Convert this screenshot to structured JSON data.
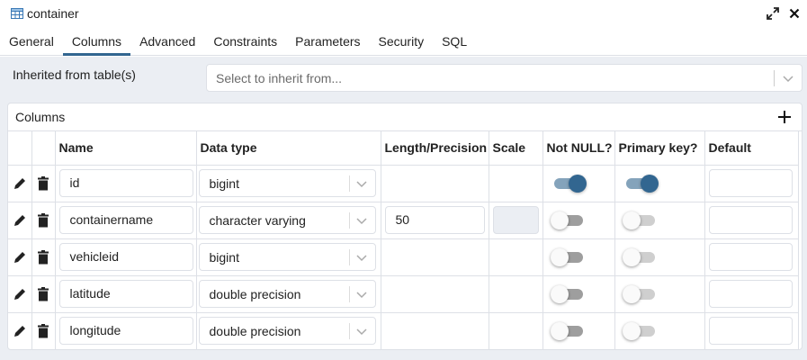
{
  "window": {
    "title": "container",
    "title_icon": "table-icon"
  },
  "tabs": [
    {
      "label": "General",
      "active": false
    },
    {
      "label": "Columns",
      "active": true
    },
    {
      "label": "Advanced",
      "active": false
    },
    {
      "label": "Constraints",
      "active": false
    },
    {
      "label": "Parameters",
      "active": false
    },
    {
      "label": "Security",
      "active": false
    },
    {
      "label": "SQL",
      "active": false
    }
  ],
  "inherit": {
    "label": "Inherited from table(s)",
    "placeholder": "Select to inherit from..."
  },
  "columns_panel": {
    "title": "Columns",
    "headers": [
      "Name",
      "Data type",
      "Length/Precision",
      "Scale",
      "Not NULL?",
      "Primary key?",
      "Default"
    ],
    "rows": [
      {
        "name": "id",
        "data_type": "bigint",
        "length": "",
        "scale": "",
        "not_null": true,
        "primary_key": true,
        "default": ""
      },
      {
        "name": "containername",
        "data_type": "character varying",
        "length": "50",
        "scale": "",
        "not_null": false,
        "primary_key": false,
        "default": ""
      },
      {
        "name": "vehicleid",
        "data_type": "bigint",
        "length": "",
        "scale": "",
        "not_null": false,
        "primary_key": false,
        "default": ""
      },
      {
        "name": "latitude",
        "data_type": "double precision",
        "length": "",
        "scale": "",
        "not_null": false,
        "primary_key": false,
        "default": ""
      },
      {
        "name": "longitude",
        "data_type": "double precision",
        "length": "",
        "scale": "",
        "not_null": false,
        "primary_key": false,
        "default": ""
      }
    ]
  },
  "colors": {
    "accent": "#326690",
    "toggle_on_track": "#84a3bb",
    "background": "#ebeef3"
  }
}
